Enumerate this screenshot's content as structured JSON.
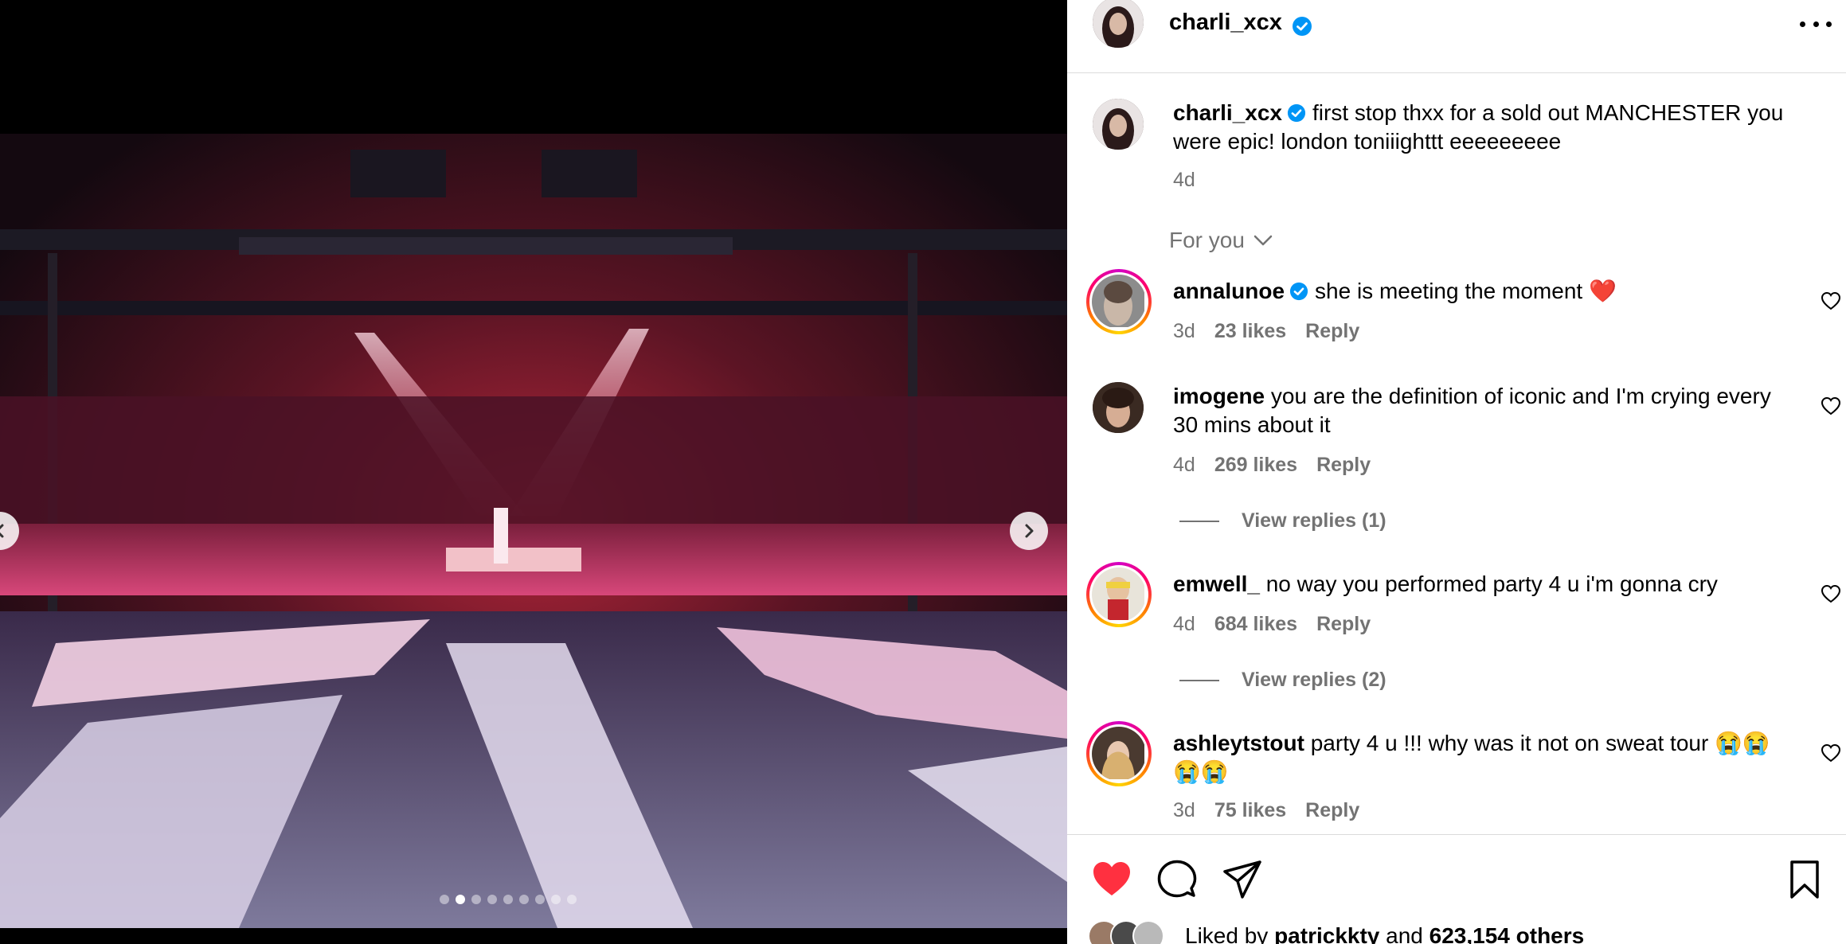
{
  "post": {
    "author": "charli_xcx",
    "caption_text": "first stop thxx for a sold out MANCHESTER you were epic! london toniiighttt eeeeeeeee",
    "time": "4d"
  },
  "media": {
    "dot_count": 9,
    "active_index": 1
  },
  "comments_sort": "For you",
  "comments": [
    {
      "user": "annalunoe",
      "verified": true,
      "text": "she is meeting the moment ❤️",
      "time": "3d",
      "likes": "23 likes",
      "reply": "Reply"
    },
    {
      "user": "imogene",
      "verified": false,
      "text": "you are the definition of iconic and I'm crying every 30 mins about it",
      "time": "4d",
      "likes": "269 likes",
      "reply": "Reply",
      "view_replies": "View replies (1)"
    },
    {
      "user": "emwell_",
      "verified": false,
      "text": "no way you performed party 4 u i'm gonna cry",
      "time": "4d",
      "likes": "684 likes",
      "reply": "Reply",
      "view_replies": "View replies (2)"
    },
    {
      "user": "ashleytstout",
      "verified": false,
      "text": "party 4 u !!! why was it not on sweat tour 😭😭😭😭",
      "time": "3d",
      "likes": "75 likes",
      "reply": "Reply"
    }
  ],
  "likes_summary": {
    "prefix": "Liked by",
    "user": "patrickkty",
    "conj": "and",
    "others": "623,154 others"
  },
  "colors": {
    "verified": "#0095f6",
    "like_red": "#ff3040",
    "secondary_text": "#737373"
  }
}
